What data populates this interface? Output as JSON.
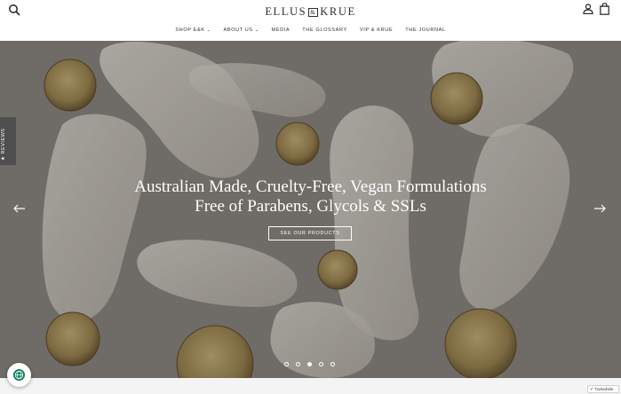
{
  "header": {
    "logo_left": "ELLUS",
    "logo_amp": "&",
    "logo_right": "KRUE",
    "search_icon": "search-icon",
    "account_icon": "user-icon",
    "cart_icon": "shopping-bag-icon"
  },
  "nav": {
    "items": [
      {
        "label": "SHOP E&K",
        "has_dropdown": true
      },
      {
        "label": "ABOUT US",
        "has_dropdown": true
      },
      {
        "label": "MEDIA",
        "has_dropdown": false
      },
      {
        "label": "THE GLOSSARY",
        "has_dropdown": false
      },
      {
        "label": "VIP & KRUE",
        "has_dropdown": false
      },
      {
        "label": "THE JOURNAL",
        "has_dropdown": false
      }
    ]
  },
  "hero": {
    "headline_line1": "Australian Made, Cruelty-Free, Vegan Formulations",
    "headline_line2": "Free of Parabens, Glycols & SSLs",
    "cta_label": "SEE OUR PRODUCTS",
    "slide_count": 5,
    "active_slide": 3,
    "prev_icon": "arrow-left-icon",
    "next_icon": "arrow-right-icon"
  },
  "reviews_tab": {
    "label": "★ REVIEWS"
  },
  "trusted_badge": {
    "label": "TrustedSite"
  },
  "colors": {
    "hero_bg": "#8a8580",
    "text_dark": "#2b2b2b",
    "reviews_tab_bg": "#4e4e4e",
    "accessibility_green": "#0b7a5b"
  }
}
